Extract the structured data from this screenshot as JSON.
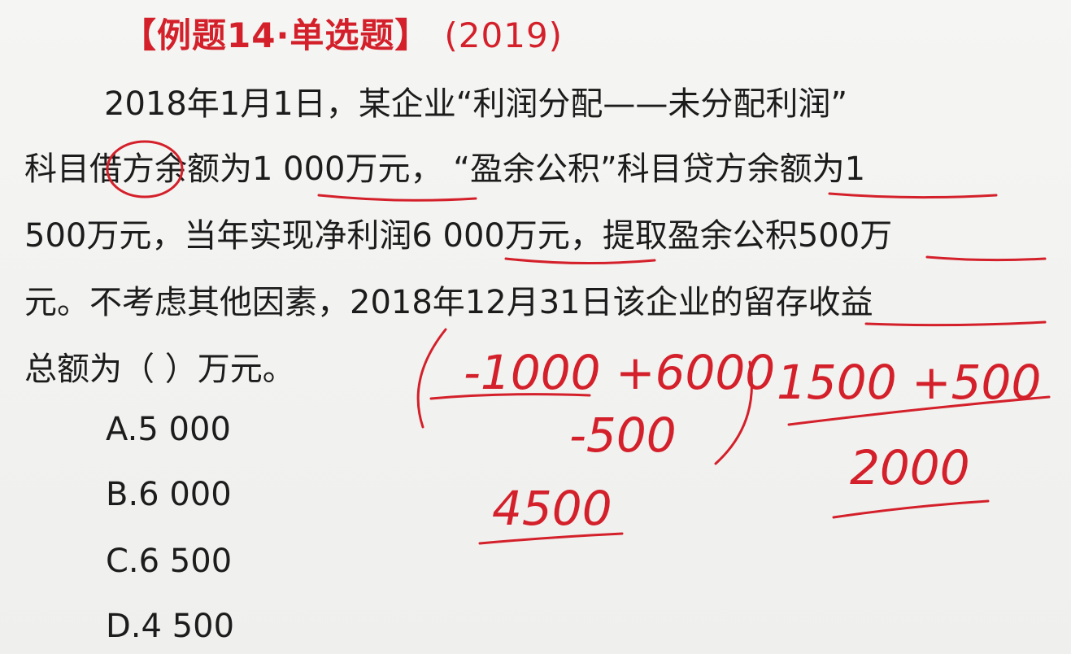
{
  "question": {
    "title": "【例题14·单选题】",
    "year": "(2019)",
    "lines": [
      "2018年1月1日，某企业“利润分配——未分配利润”",
      "科目借方余额为1 000万元，  “盈余公积”科目贷方余额为1",
      "500万元，当年实现净利润6 000万元，提取盈余公积500万",
      "元。不考虑其他因素，2018年12月31日该企业的留存收益",
      "总额为（    ）万元。"
    ],
    "options": [
      "A.5 000",
      "B.6 000",
      "C.6 500",
      "D.4 500"
    ]
  },
  "annotations": {
    "left_calc_top": "-1000 +6000",
    "left_calc_sub": "-500",
    "left_calc_result": "4500",
    "right_calc_top": "1500 +500",
    "right_calc_result": "2000"
  },
  "colors": {
    "accent": "#d4202a",
    "text": "#1c1c1c"
  }
}
